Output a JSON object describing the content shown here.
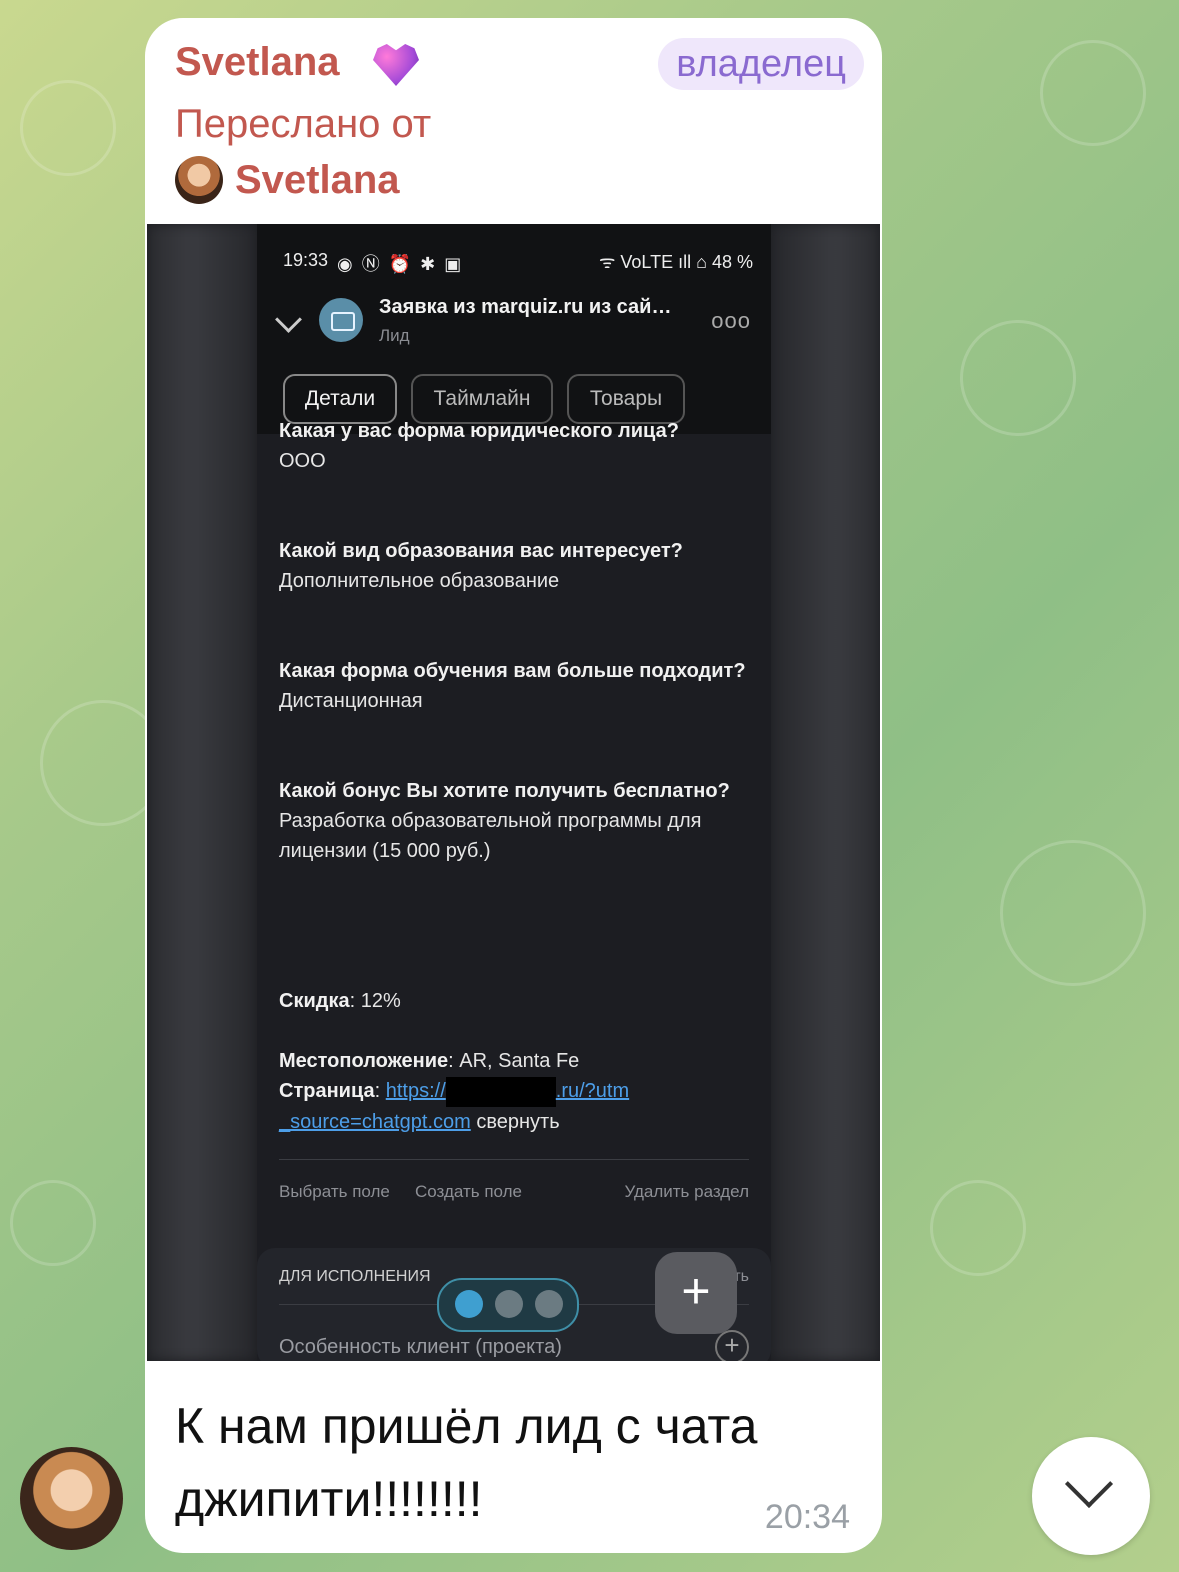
{
  "message": {
    "sender": "Svetlana",
    "role_badge": "владелец",
    "forwarded_label": "Переслано от",
    "forwarded_from": "Svetlana",
    "text": "К нам пришёл лид с чата джипити!!!!!!!!",
    "time": "20:34"
  },
  "screenshot": {
    "status_time": "19:33",
    "status_icons": "◉ Ⓝ ⏰ ✱ ▣",
    "status_right": "ᯤ VoLTE ıll ⌂ 48 %",
    "header_title": "Заявка из marquiz.ru из сай…",
    "header_subtitle": "Лид",
    "more_icon": "ooo",
    "tabs": [
      "Детали",
      "Таймлайн",
      "Товары"
    ],
    "qa": [
      {
        "q": "Какая у вас форма юридического лица?",
        "a": "ООО"
      },
      {
        "q": "Какой вид образования вас интересует?",
        "a": "Дополнительное образование"
      },
      {
        "q": "Какая форма обучения вам больше подходит?",
        "a": "Дистанционная"
      },
      {
        "q": "Какой бонус Вы хотите получить бесплатно?",
        "a": "Разработка образовательной программы для лицензии (15 000 руб.)"
      }
    ],
    "discount_label": "Скидка",
    "discount_value": ": 12%",
    "location_label": "Местоположение",
    "location_value": ": AR, Santa Fe",
    "page_label": "Страница",
    "page_colon": ": ",
    "page_link_start": "https://",
    "page_link_end": ".ru/?utm",
    "page_link_tail": "_source=chatgpt.com",
    "collapse_label": " свернуть",
    "footer_actions": [
      "Выбрать поле",
      "Создать поле",
      "Удалить раздел"
    ],
    "section_title": "ДЛЯ ИСПОЛНЕНИЯ",
    "section_edit": "изменить",
    "section_row": "Особенность клиент (проекта)",
    "fab_label": "+"
  }
}
